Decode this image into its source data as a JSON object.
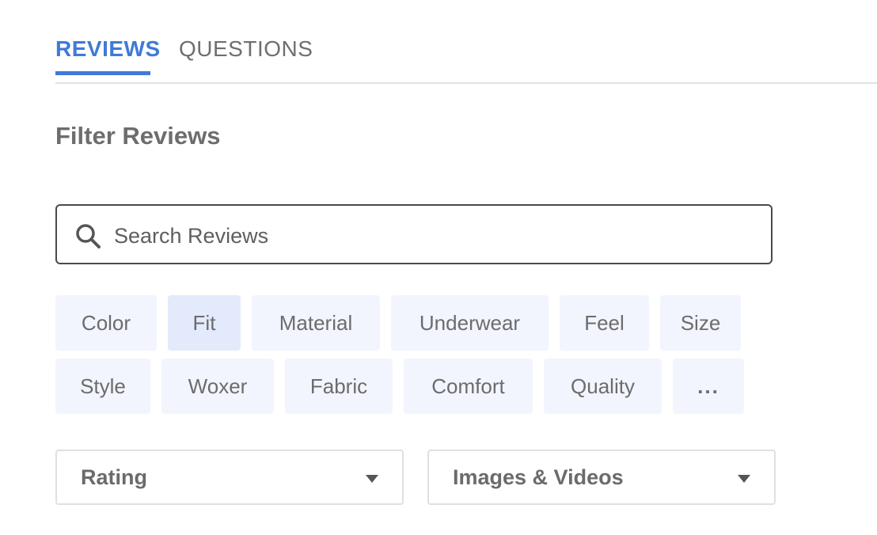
{
  "tabs": [
    {
      "label": "REVIEWS",
      "active": true
    },
    {
      "label": "QUESTIONS",
      "active": false
    }
  ],
  "filter": {
    "title": "Filter Reviews",
    "search": {
      "placeholder": "Search Reviews",
      "icon": "search-icon"
    },
    "chips": [
      {
        "label": "Color",
        "selected": false
      },
      {
        "label": "Fit",
        "selected": true
      },
      {
        "label": "Material",
        "selected": false
      },
      {
        "label": "Underwear",
        "selected": false
      },
      {
        "label": "Feel",
        "selected": false
      },
      {
        "label": "Size",
        "selected": false
      },
      {
        "label": "Style",
        "selected": false
      },
      {
        "label": "Woxer",
        "selected": false
      },
      {
        "label": "Fabric",
        "selected": false
      },
      {
        "label": "Comfort",
        "selected": false
      },
      {
        "label": "Quality",
        "selected": false
      },
      {
        "label": "...",
        "selected": false
      }
    ],
    "dropdowns": [
      {
        "label": "Rating",
        "icon": "caret-down-icon"
      },
      {
        "label": "Images & Videos",
        "icon": "caret-down-icon"
      }
    ]
  },
  "colors": {
    "accent": "#3f7ad6",
    "chip_bg": "#f2f5fd",
    "chip_selected_bg": "#e3eafb"
  }
}
